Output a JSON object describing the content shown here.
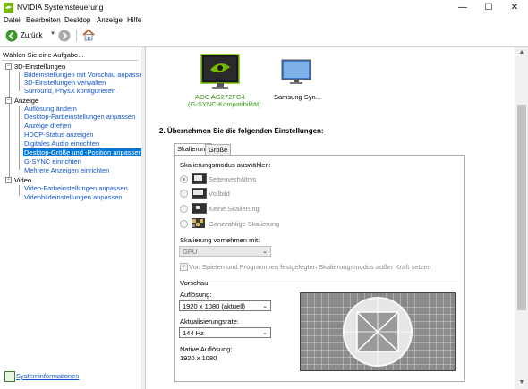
{
  "window": {
    "title": "NVIDIA Systemsteuerung",
    "min_glyph": "—",
    "max_glyph": "☐",
    "close_glyph": "✕"
  },
  "menu": [
    "Datei",
    "Bearbeiten",
    "Desktop",
    "Anzeige",
    "Hilfe"
  ],
  "toolbar": {
    "back_label": "Zurück"
  },
  "left_panel": {
    "header": "Wählen Sie eine Aufgabe...",
    "categories": [
      {
        "label": "3D-Einstellungen",
        "items": [
          "Bildeinstellungen mit Vorschau anpassen",
          "3D-Einstellungen verwalten",
          "Surround, PhysX konfigurieren"
        ]
      },
      {
        "label": "Anzeige",
        "items": [
          "Auflösung ändern",
          "Desktop-Farbeinstellungen anpassen",
          "Anzeige drehen",
          "HDCP-Status anzeigen",
          "Digitales Audio einrichten",
          "Desktop-Größe und -Position anpassen",
          "G-SYNC einrichten",
          "Mehrere Anzeigen einrichten"
        ]
      },
      {
        "label": "Video",
        "items": [
          "Video-Farbeinstellungen anpassen",
          "Videobildeinstellungen anpassen"
        ]
      }
    ],
    "selected_item": "Desktop-Größe und -Position anpassen",
    "system_info": "Systeminformationen"
  },
  "monitors": [
    {
      "name": "AOC AG272FG4",
      "subtitle": "(G-SYNC-Kompatibilität)",
      "selected": true
    },
    {
      "name": "Samsung Syn...",
      "selected": false
    }
  ],
  "section": {
    "heading": "2. Übernehmen Sie die folgenden Einstellungen:"
  },
  "tabs": [
    "Skalierung",
    "Größe"
  ],
  "active_tab": "Skalierung",
  "scaling": {
    "mode_label": "Skalierungsmodus auswählen:",
    "options": [
      "Seitenverhältnis",
      "Vollbild",
      "Keine Skalierung",
      "Ganzzahlige Skalierung"
    ],
    "selected_option": "Seitenverhältnis",
    "perform_label": "Skalierung vornehmen mit:",
    "perform_value": "GPU",
    "override_label": "Von Spielen und Programmen festgelegten Skalierungsmodus außer Kraft setzen",
    "override_checked": true
  },
  "preview": {
    "label": "Vorschau",
    "resolution_label": "Auflösung:",
    "resolution_value": "1920 x 1080 (aktuell)",
    "refresh_label": "Aktualisierungsrate:",
    "refresh_value": "144 Hz",
    "native_label": "Native Auflösung:",
    "native_value": "1920 x 1080"
  },
  "colors": {
    "accent": "#0078d7",
    "link": "#1155cc",
    "nvidia_green": "#76b900",
    "selected_monitor_label": "#3a9a18"
  }
}
